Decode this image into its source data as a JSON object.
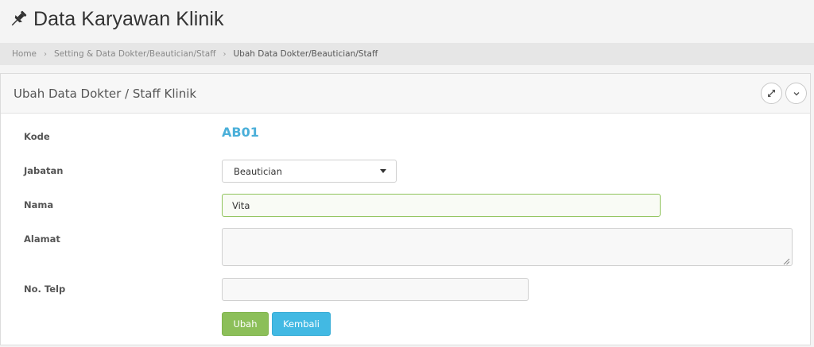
{
  "header": {
    "title": "Data Karyawan Klinik",
    "icon": "pin-icon"
  },
  "breadcrumb": [
    "Home",
    "Setting & Data Dokter/Beautician/Staff",
    "Ubah Data Dokter/Beautician/Staff"
  ],
  "panel": {
    "title": "Ubah Data Dokter / Staff Klinik",
    "tools": [
      "expand-icon",
      "chevron-down-icon"
    ]
  },
  "form": {
    "kode": {
      "label": "Kode",
      "value": "AB01"
    },
    "jabatan": {
      "label": "Jabatan",
      "selected": "Beautician"
    },
    "nama": {
      "label": "Nama",
      "value": "Vita"
    },
    "alamat": {
      "label": "Alamat",
      "value": ""
    },
    "telp": {
      "label": "No. Telp",
      "value": ""
    }
  },
  "buttons": {
    "ubah": "Ubah",
    "kembali": "Kembali"
  },
  "colors": {
    "accent_blue": "#42b9e3",
    "accent_green": "#8cbf59",
    "kode_text": "#4aafd9"
  }
}
